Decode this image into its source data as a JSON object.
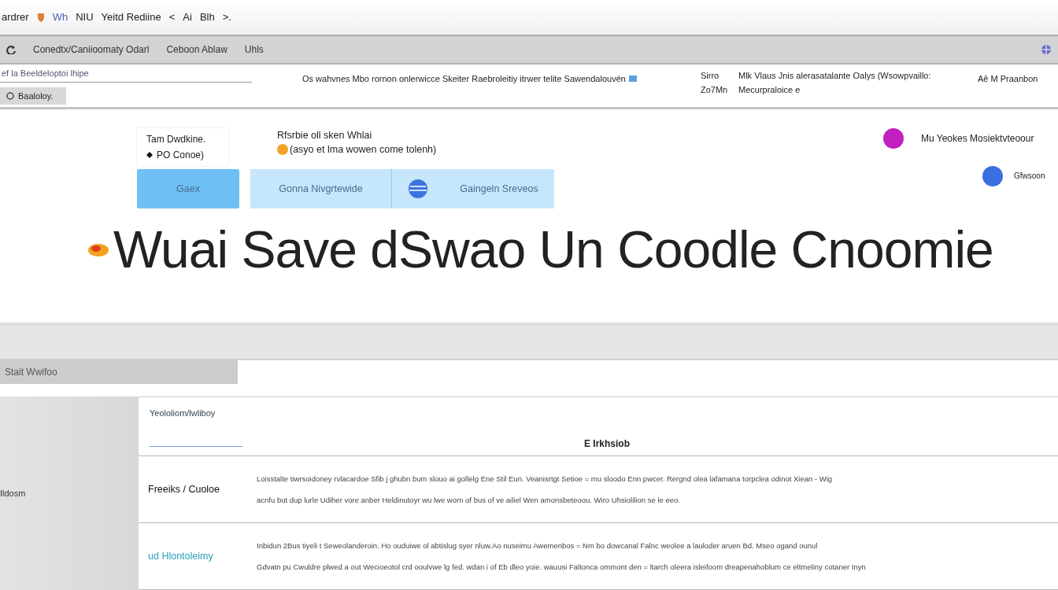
{
  "title_bar": {
    "items": [
      "ardrer",
      "Wh",
      "NIU",
      "Yeitd Rediine",
      "<",
      "Ai",
      "Blh",
      ">."
    ]
  },
  "toolbar": {
    "items": [
      "Conedtx/Caniioomaty Odarl",
      "Ceboon Ablaw",
      "Uhls"
    ]
  },
  "search": {
    "value": "ef la Beeldeloptoi lhipe"
  },
  "side_tab": {
    "label": "Baaloloy.",
    "selected": true
  },
  "notice": "Os wahvnes Mbo rornon onlerwicce Skeiter Raebroleitiy itrwer telite Sawendalouvén",
  "info": [
    {
      "label": "Sirro",
      "text": "Mlk Vlaus Jnis alerasatalante Oalys (Wsowpvaillo:"
    },
    {
      "label": "Zo7Mn",
      "text": "Mecurpraloice e"
    }
  ],
  "account": "Aê M Praanbon",
  "hero": {
    "card_lines": [
      "Tam Dwdkine.",
      "PO Conoe)"
    ],
    "intro_lines": [
      "Rfsrbie oll sken Whlai",
      "(asyo et lma wowen come tolenh)"
    ],
    "buttons": [
      {
        "label": "Gaex",
        "selected": true
      },
      {
        "label": "Gonna Nivgrtewide",
        "selected": false
      },
      {
        "label": "Gaingeln Sreveos",
        "selected": false
      }
    ],
    "side": [
      {
        "label": "Mu Yeokes Mosiektvteoour",
        "color": "#c21fc0"
      },
      {
        "label": "Gfwsoon",
        "color": "#3b6fe0"
      }
    ],
    "headline": "Wuai Save dSwao Un Coodle Cnoomie"
  },
  "section_tab": {
    "label": "Stait Wwifoo"
  },
  "sidebar_label": "Ildosm",
  "table": {
    "columns": [
      "Yeololiom/lwliboy",
      "E Irkhsiob"
    ],
    "rows": [
      {
        "label": "Freeiks / Cuoloe",
        "kind": "plain",
        "lines": [
          "Loisstalte tiwrsoidoney rvlacardoe  Sfib j ghubn bum slouo ai gollelg Ene Stil  Eun. Veanisrtgt Setioe  =  mu  sloodo Enn pwcer. Rergnd olea lafamana torpclea odinot  Xiean - Wig",
          "acnfu but dup lurle Udiher vore anber  Heldinutoyr wu lwe  worn of bus of ve ailiel Wen  amonsbeteoou. Wiro Uhsiolilion  se le eeo."
        ]
      },
      {
        "label": "ud Hlontoleimy",
        "kind": "link",
        "lines": [
          "Inbidun  2Bus tiyeli t Seweolanderoin.  Ho ouduiwe ol abtislug syer  nluw.Ao  nuseimu Awemenbos  =  Nm  bo dowcanal Falnc weolee a lauloder aruen Bd.   Mseo ogand  ounul",
          "Gdvatn  pu Cwuldre plwed a out  Wecioeotol crd ooulvwe lg fed. wdan i of Eb dleo yoie.  wauusi Faltonca ommont den  =  ltarch oleera  isleifoom dreapenahoblum  ce eltmeliny  cotaner Inyn"
        ]
      }
    ]
  }
}
